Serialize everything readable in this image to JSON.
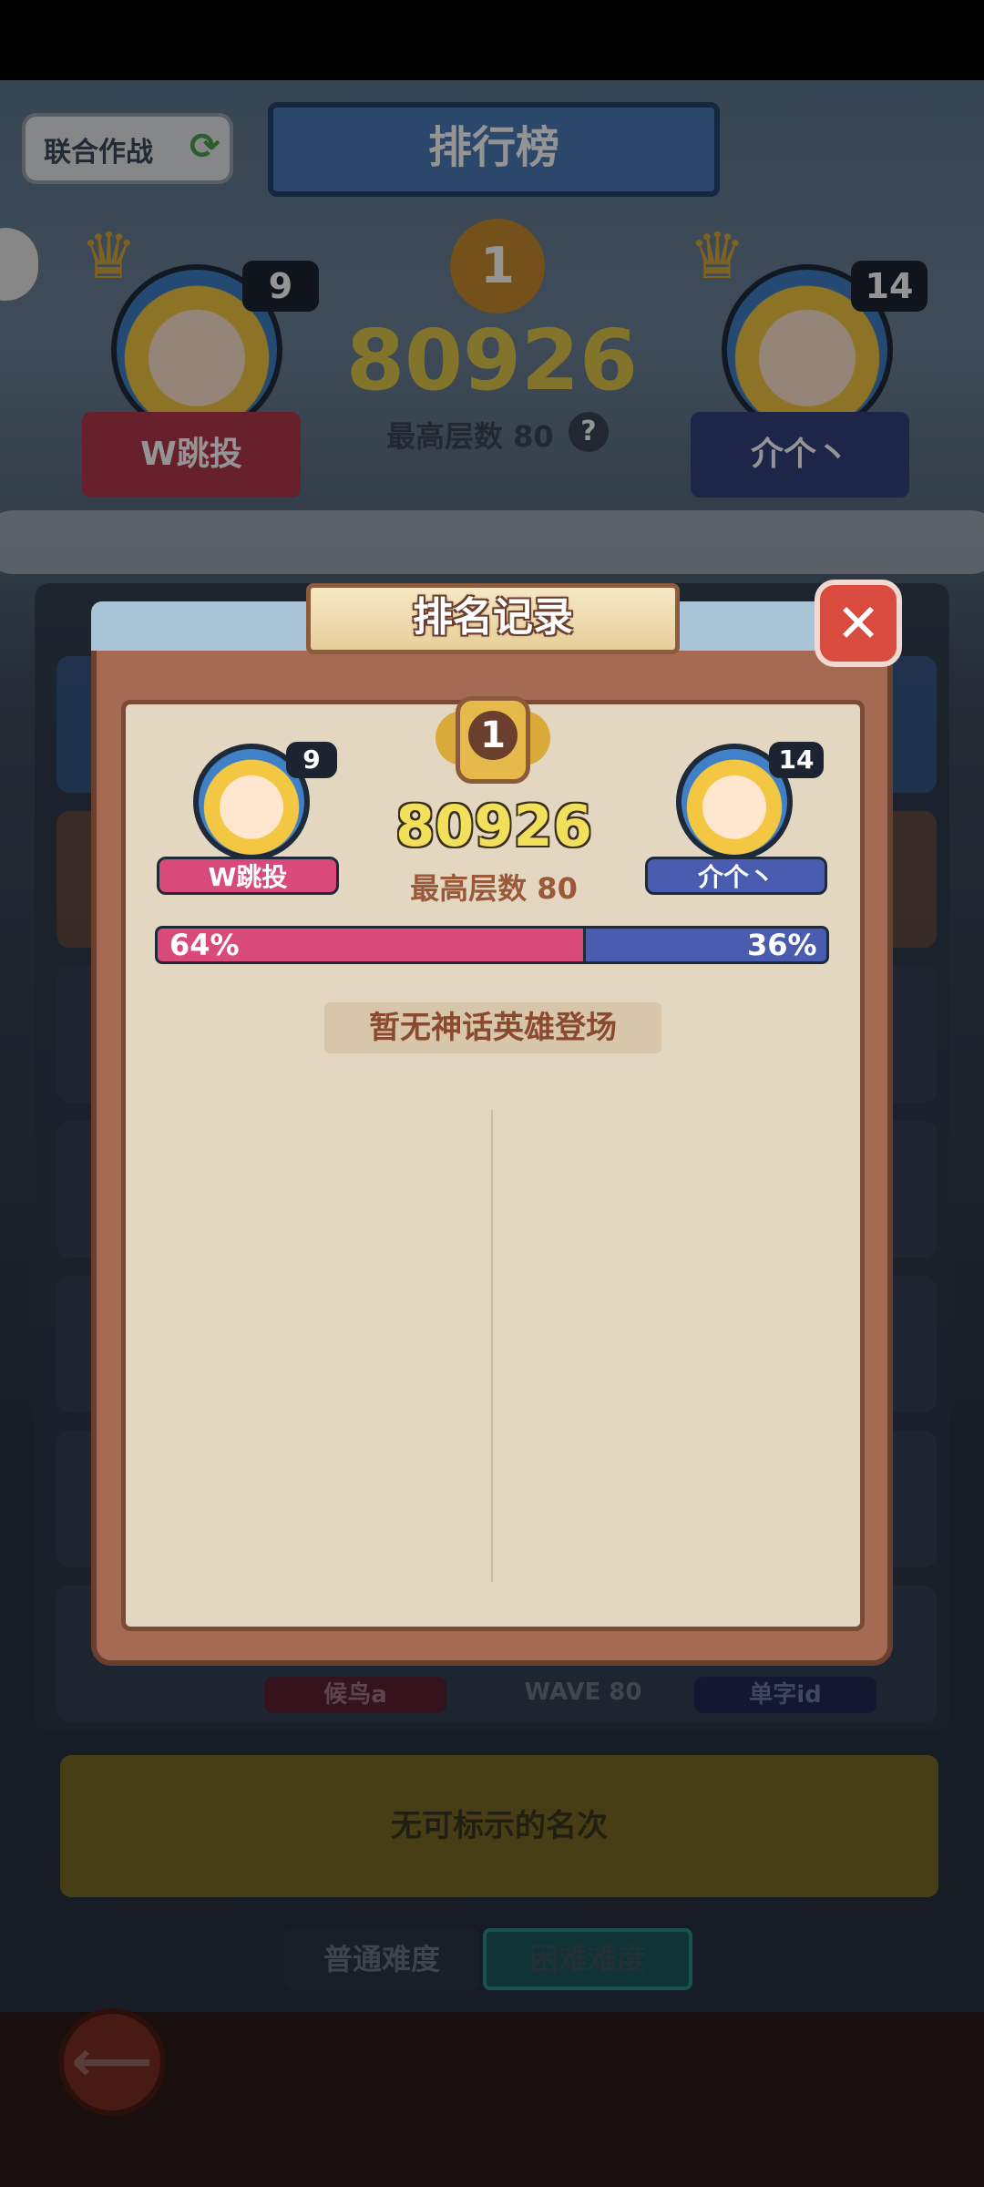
{
  "background": {
    "coop_button": "联合作战",
    "ranking_title": "排行榜",
    "left_player": {
      "name": "W跳投",
      "level": "9"
    },
    "right_player": {
      "name": "介个丶",
      "level": "14"
    },
    "score": "80926",
    "max_floor": "最高层数 80",
    "help": "?",
    "row_left_name": "候鸟a",
    "row_wave": "WAVE 80",
    "row_right_name": "单字id",
    "no_rank_text": "无可标示的名次",
    "difficulty_tabs": [
      {
        "label": "普通难度",
        "active": false
      },
      {
        "label": "困难难度",
        "active": true
      }
    ]
  },
  "popup": {
    "title": "排名记录",
    "rank": "1",
    "score": "80926",
    "max_floor": "最高层数 80",
    "left_player": {
      "name": "W跳投",
      "level": "9",
      "color": "#d94a7a"
    },
    "right_player": {
      "name": "介个丶",
      "level": "14",
      "color": "#4a5cb0"
    },
    "left_percent_label": "64%",
    "right_percent_label": "36%",
    "left_share": 0.64,
    "empty_text": "暂无神话英雄登场"
  },
  "icons": [
    "refresh-icon",
    "close-icon",
    "back-arrow-icon",
    "crown-icon",
    "medal-icon",
    "help-icon"
  ]
}
